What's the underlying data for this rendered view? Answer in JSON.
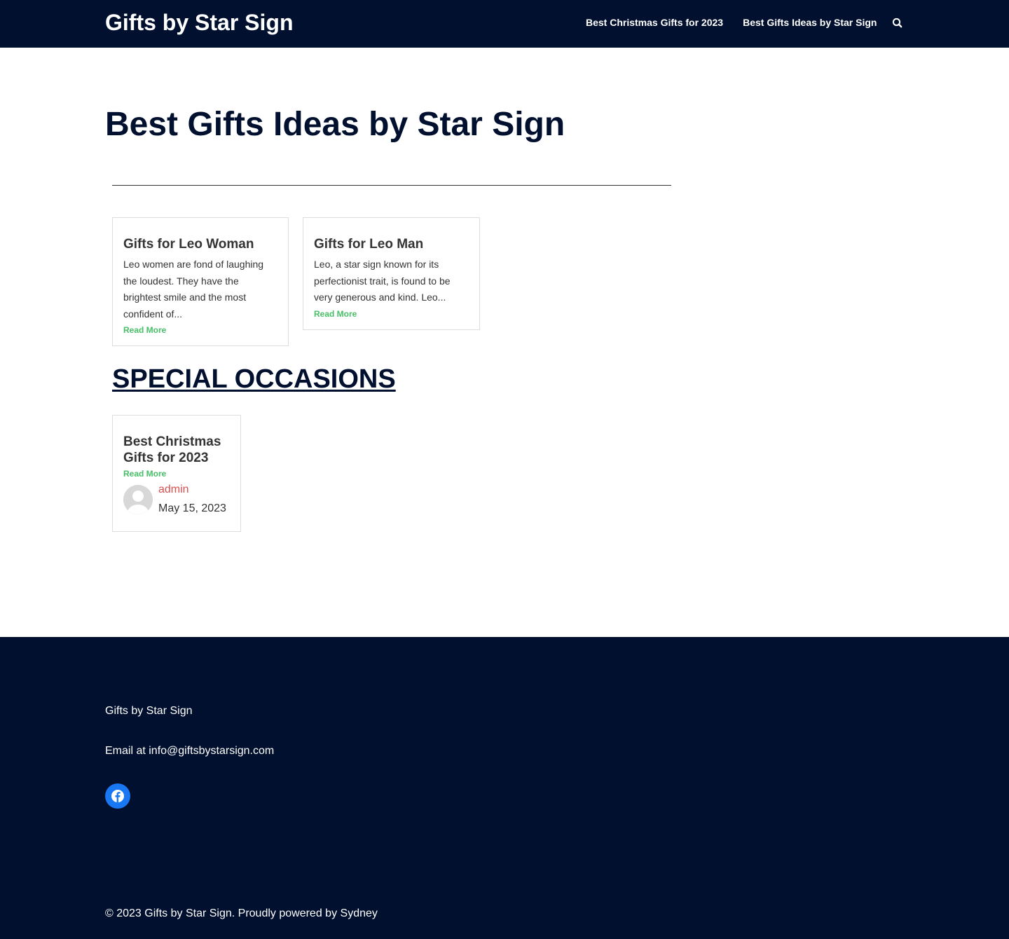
{
  "header": {
    "site_title": "Gifts by Star Sign",
    "nav": [
      "Best Christmas Gifts for 2023",
      "Best Gifts Ideas by Star Sign"
    ],
    "search_icon": "search-icon"
  },
  "main": {
    "page_title": "Best Gifts Ideas by Star Sign",
    "posts": [
      {
        "title": "Gifts for Leo Woman",
        "excerpt": "Leo women are fond of laughing the loudest. They have the brightest smile and the most confident of...",
        "read_more": "Read More"
      },
      {
        "title": "Gifts for Leo Man",
        "excerpt": "Leo, a star sign known for its perfectionist trait, is found to be very generous and kind. Leo...",
        "read_more": "Read More"
      }
    ],
    "section_heading": "SPECIAL OCCASIONS",
    "special_post": {
      "title": "Best Christmas Gifts for 2023",
      "read_more": "Read More",
      "author": "admin",
      "date": "May 15, 2023"
    }
  },
  "footer": {
    "title": "Gifts by Star Sign",
    "email": "Email at info@giftsbystarsign.com",
    "social_icon": "facebook-icon",
    "copyright": "© 2023 Gifts by Star Sign. Proudly powered by Sydney"
  },
  "colors": {
    "navy": "#00102e",
    "accent_green": "#47c068",
    "author_red": "#d65050",
    "facebook_blue": "#1877f2"
  }
}
